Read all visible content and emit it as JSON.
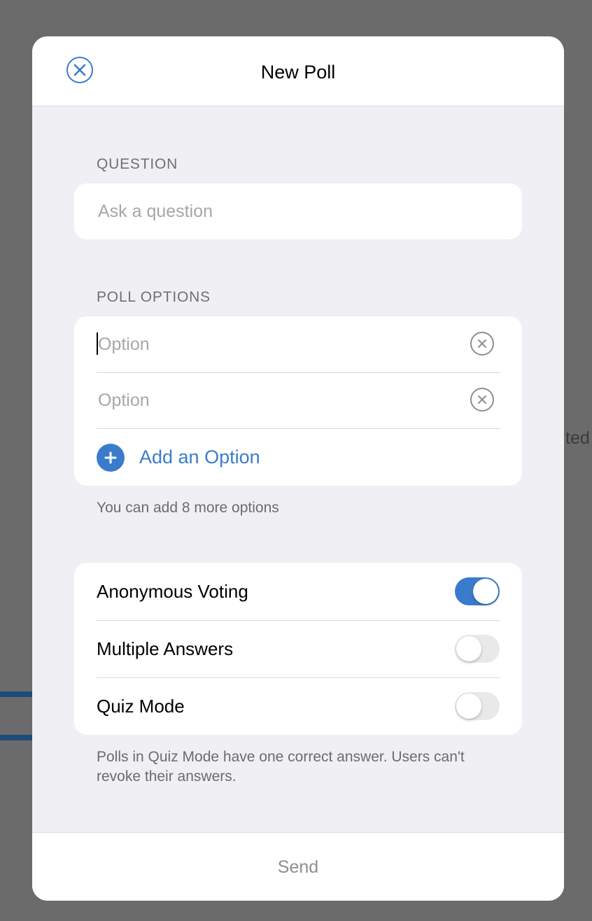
{
  "background": {
    "partial_text": "ted"
  },
  "modal": {
    "title": "New Poll",
    "close_icon": "close-circle-icon"
  },
  "question": {
    "label": "QUESTION",
    "placeholder": "Ask a question",
    "value": ""
  },
  "poll_options": {
    "label": "POLL OPTIONS",
    "options": [
      {
        "placeholder": "Option",
        "value": "",
        "focused": true
      },
      {
        "placeholder": "Option",
        "value": "",
        "focused": false
      }
    ],
    "add_label": "Add an Option",
    "remaining_hint": "You can add 8 more options"
  },
  "settings": {
    "toggles": [
      {
        "label": "Anonymous Voting",
        "on": true
      },
      {
        "label": "Multiple Answers",
        "on": false
      },
      {
        "label": "Quiz Mode",
        "on": false
      }
    ],
    "quiz_hint": "Polls in Quiz Mode have one correct answer. Users can't revoke their answers."
  },
  "footer": {
    "send_label": "Send"
  },
  "colors": {
    "accent": "#3a7ccb",
    "toggle_off": "#e9e9ea",
    "placeholder": "#a6a6ab",
    "overlay": "#6b6b6b"
  }
}
